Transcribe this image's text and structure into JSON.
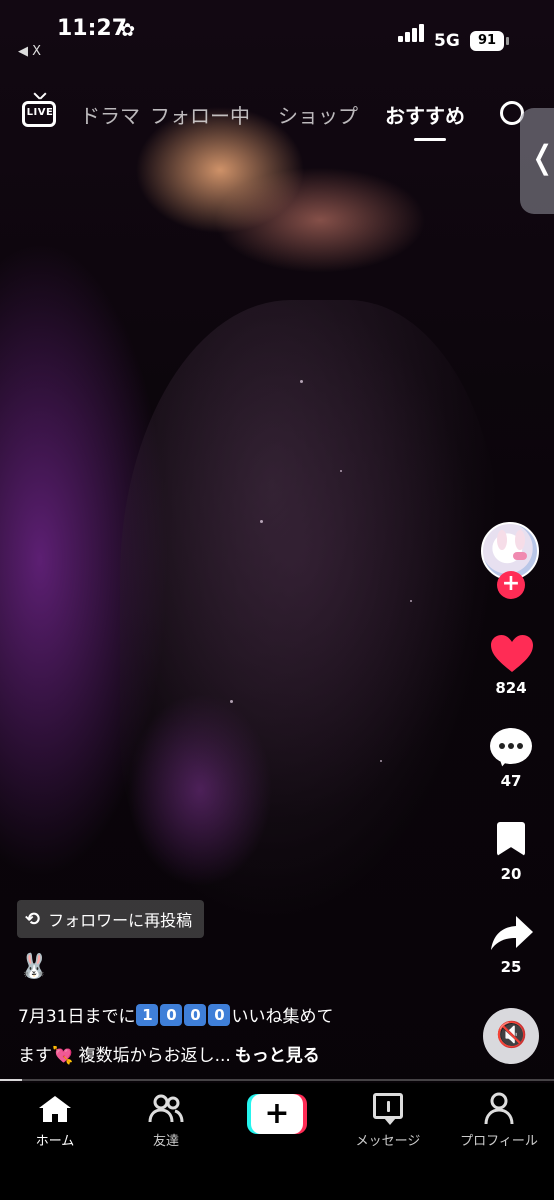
{
  "status_bar": {
    "time": "11:27",
    "time_icon": "✿",
    "back_app": "◀ X",
    "network": "5G",
    "battery": "91"
  },
  "top_nav": {
    "live_label": "LIVE",
    "tabs": [
      {
        "label": "ドラマ",
        "active": false
      },
      {
        "label": "フォロー中",
        "active": false
      },
      {
        "label": "ショップ",
        "active": false
      },
      {
        "label": "おすすめ",
        "active": true
      }
    ]
  },
  "side_handle": {
    "glyph": "❬"
  },
  "actions": {
    "follow_glyph": "+",
    "likes": "824",
    "comments": "47",
    "saves": "20",
    "shares": "25",
    "mute_glyph": "🔇"
  },
  "post": {
    "repost_icon": "⟲",
    "repost_text": "フォロワーに再投稿",
    "username": "🐰",
    "caption_part1": "7月31日までに",
    "caption_digits": [
      "1",
      "0",
      "0",
      "0"
    ],
    "caption_part2": "いいね集めて",
    "caption_line2_start": "ます",
    "caption_heart": "💘",
    "caption_line2_text": " 複数垢からお返し...",
    "more": "もっと見る",
    "progress": 0.04
  },
  "bottom_nav": {
    "home": "ホーム",
    "friends": "友達",
    "create_glyph": "+",
    "inbox": "メッセージ",
    "profile": "プロフィール"
  },
  "colors": {
    "accent": "#fe2c55",
    "accent_cyan": "#25f4ee",
    "heart": "#ff2c55"
  }
}
